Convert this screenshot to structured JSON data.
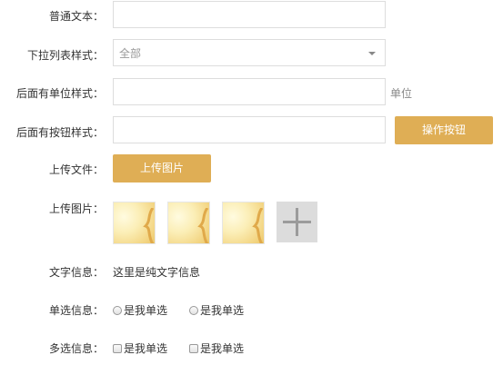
{
  "form": {
    "plain_text": {
      "label": "普通文本：",
      "value": ""
    },
    "dropdown": {
      "label": "下拉列表样式：",
      "selected": "全部"
    },
    "unit_field": {
      "label": "后面有单位样式：",
      "value": "",
      "unit": "单位"
    },
    "button_field": {
      "label": "后面有按钮样式：",
      "value": "",
      "button": "操作按钮"
    },
    "upload_file": {
      "label": "上传文件：",
      "button": "上传图片"
    },
    "upload_image": {
      "label": "上传图片：",
      "thumbnails": 3,
      "add_icon": "plus-icon"
    },
    "text_info": {
      "label": "文字信息：",
      "value": "这里是纯文字信息"
    },
    "radio_info": {
      "label": "单选信息：",
      "options": [
        "是我单选",
        "是我单选"
      ]
    },
    "checkbox_info": {
      "label": "多选信息：",
      "options": [
        "是我单选",
        "是我单选"
      ]
    }
  },
  "colors": {
    "accent": "#dfae55",
    "border": "#dddddd",
    "label": "#333333",
    "muted": "#999999"
  }
}
